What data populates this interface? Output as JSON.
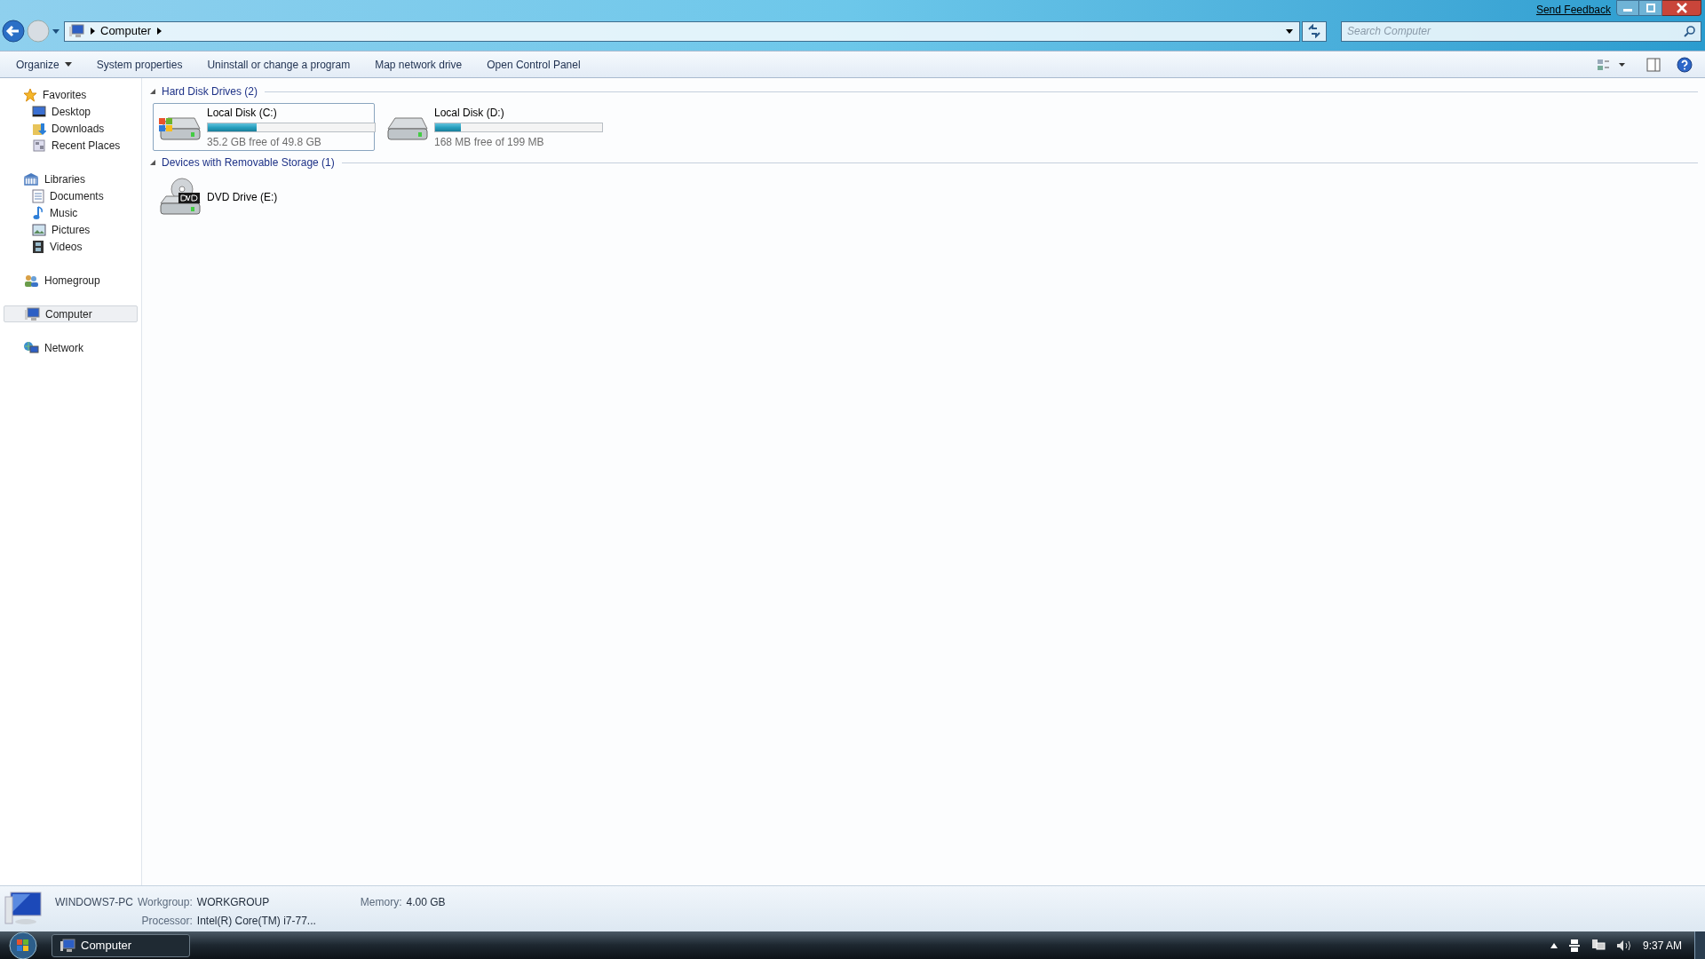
{
  "window": {
    "send_feedback": "Send Feedback"
  },
  "address": {
    "breadcrumb": [
      "Computer"
    ]
  },
  "search": {
    "placeholder": "Search Computer"
  },
  "toolbar": [
    {
      "label": "Organize",
      "kind": "menu"
    },
    {
      "label": "System properties",
      "kind": "button"
    },
    {
      "label": "Uninstall or change a program",
      "kind": "button"
    },
    {
      "label": "Map network drive",
      "kind": "button"
    },
    {
      "label": "Open Control Panel",
      "kind": "button"
    }
  ],
  "sidebar": [
    {
      "label": "Favorites",
      "selected": false,
      "children": [
        {
          "label": "Desktop",
          "selected": false
        },
        {
          "label": "Downloads",
          "selected": false
        },
        {
          "label": "Recent Places",
          "selected": false
        }
      ]
    },
    {
      "label": "Libraries",
      "selected": false,
      "children": [
        {
          "label": "Documents",
          "selected": false
        },
        {
          "label": "Music",
          "selected": false
        },
        {
          "label": "Pictures",
          "selected": false
        },
        {
          "label": "Videos",
          "selected": false
        }
      ]
    },
    {
      "label": "Homegroup",
      "selected": false
    },
    {
      "label": "Computer",
      "selected": true
    },
    {
      "label": "Network",
      "selected": false
    }
  ],
  "groups": [
    {
      "title": "Hard Disk Drives (2)",
      "expanded": true,
      "items": [
        {
          "kind": "disk",
          "system": true,
          "name": "Local Disk (C:)",
          "level": 0.293,
          "free": "35.2 GB free of 49.8 GB",
          "selected": true
        },
        {
          "kind": "disk",
          "system": false,
          "name": "Local Disk (D:)",
          "level": 0.156,
          "free": "168 MB free of 199 MB",
          "selected": false
        }
      ]
    },
    {
      "title": "Devices with Removable Storage (1)",
      "expanded": true,
      "items": [
        {
          "kind": "dvd",
          "name": "DVD Drive (E:)",
          "selected": false
        }
      ]
    }
  ],
  "details": {
    "name": "WINDOWS7-PC",
    "fields": [
      {
        "label": "Workgroup:",
        "value": "WORKGROUP"
      },
      {
        "label": "Memory:",
        "value": "4.00 GB"
      },
      {
        "label": "Processor:",
        "value": "Intel(R) Core(TM) i7-77..."
      }
    ]
  },
  "taskbar": {
    "tasks": [
      {
        "label": "Computer",
        "selected": true
      }
    ],
    "clock": "9:37 AM"
  }
}
